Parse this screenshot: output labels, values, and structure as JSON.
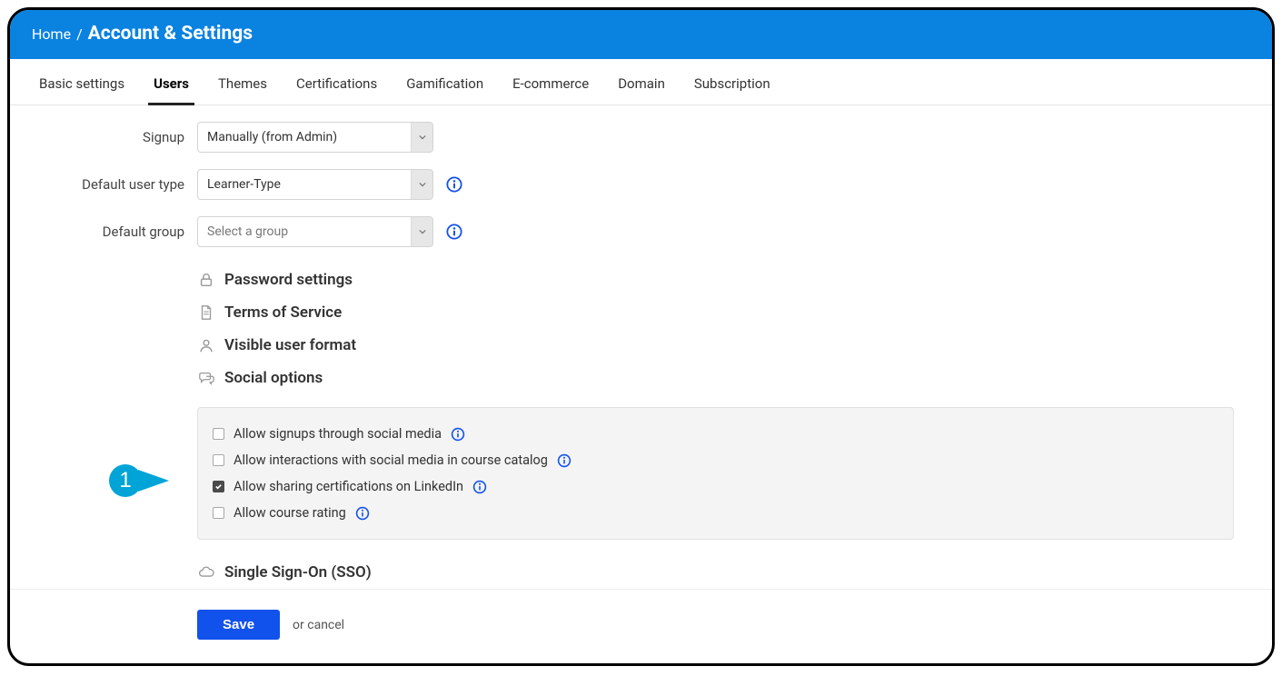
{
  "breadcrumb": {
    "home": "Home",
    "sep": "/",
    "page": "Account & Settings"
  },
  "tabs": {
    "basic": "Basic settings",
    "users": "Users",
    "themes": "Themes",
    "certifications": "Certifications",
    "gamification": "Gamification",
    "ecommerce": "E-commerce",
    "domain": "Domain",
    "subscription": "Subscription"
  },
  "form": {
    "signup_label": "Signup",
    "signup_value": "Manually (from Admin)",
    "default_user_type_label": "Default user type",
    "default_user_type_value": "Learner-Type",
    "default_group_label": "Default group",
    "default_group_placeholder": "Select a group"
  },
  "sections": {
    "password": "Password settings",
    "tos": "Terms of Service",
    "user_format": "Visible user format",
    "social": "Social options",
    "sso": "Single Sign-On (SSO)"
  },
  "social_options": {
    "signups": {
      "label": "Allow signups through social media",
      "checked": false
    },
    "interactions": {
      "label": "Allow interactions with social media in course catalog",
      "checked": false
    },
    "linkedin": {
      "label": "Allow sharing certifications on LinkedIn",
      "checked": true
    },
    "rating": {
      "label": "Allow course rating",
      "checked": false
    }
  },
  "footer": {
    "save": "Save",
    "or": "or ",
    "cancel": "cancel"
  },
  "callout": {
    "number": "1"
  }
}
